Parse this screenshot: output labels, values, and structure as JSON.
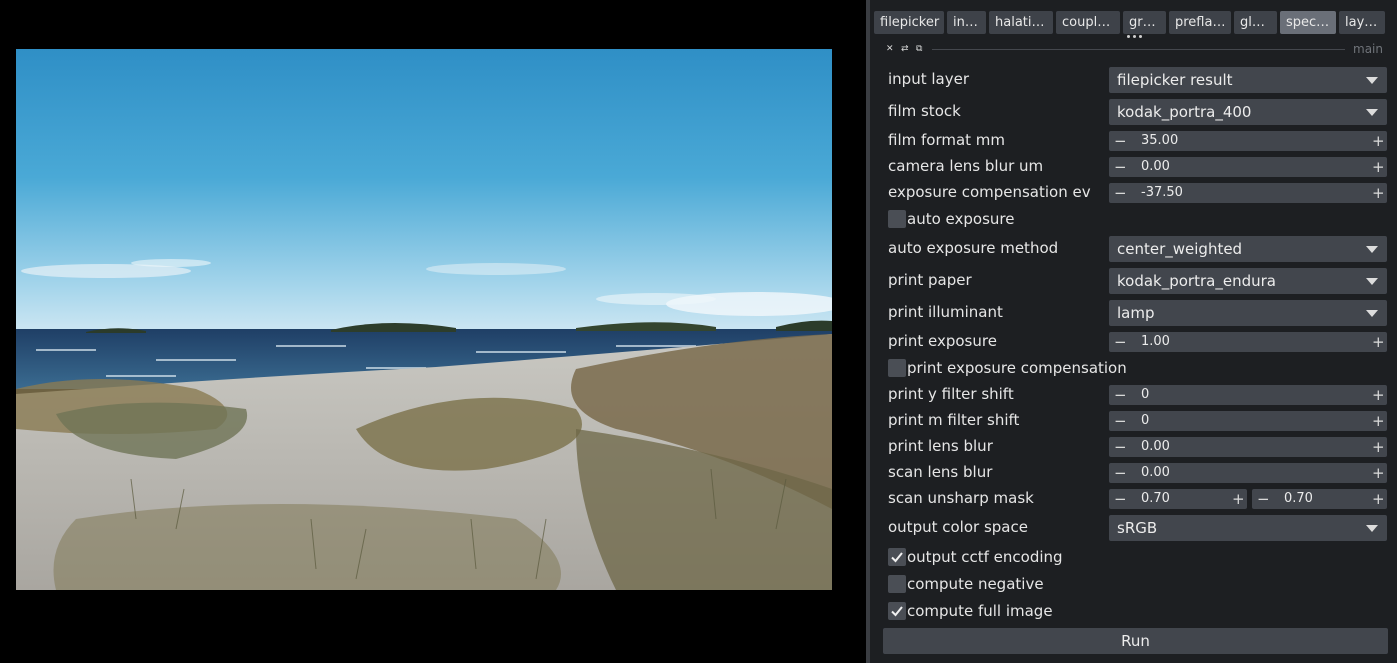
{
  "tabs": [
    {
      "label": "filepicker",
      "width": 70,
      "active": false
    },
    {
      "label": "in…",
      "width": 39,
      "active": false
    },
    {
      "label": "halati…",
      "width": 64,
      "active": false
    },
    {
      "label": "coupl…",
      "width": 64,
      "active": false
    },
    {
      "label": "gr…",
      "width": 43,
      "active": false
    },
    {
      "label": "prefla…",
      "width": 62,
      "active": false
    },
    {
      "label": "gl…",
      "width": 43,
      "active": false
    },
    {
      "label": "spec…",
      "width": 56,
      "active": true
    },
    {
      "label": "lay…",
      "width": 46,
      "active": false
    }
  ],
  "dock": {
    "label": "main"
  },
  "form": {
    "input_layer": {
      "label": "input layer",
      "value": "filepicker result"
    },
    "film_stock": {
      "label": "film stock",
      "value": "kodak_portra_400"
    },
    "film_format_mm": {
      "label": "film format mm",
      "value": "35.00"
    },
    "camera_lens_blur_um": {
      "label": "camera lens blur um",
      "value": "0.00"
    },
    "exposure_compensation_ev": {
      "label": "exposure compensation ev",
      "value": "-37.50"
    },
    "auto_exposure": {
      "label": "auto exposure",
      "checked": false
    },
    "auto_exposure_method": {
      "label": "auto exposure method",
      "value": "center_weighted"
    },
    "print_paper": {
      "label": "print paper",
      "value": "kodak_portra_endura"
    },
    "print_illuminant": {
      "label": "print illuminant",
      "value": "lamp"
    },
    "print_exposure": {
      "label": "print exposure",
      "value": "1.00"
    },
    "print_exposure_compensation": {
      "label": "print exposure compensation",
      "checked": false
    },
    "print_y_filter_shift": {
      "label": "print y filter shift",
      "value": "0"
    },
    "print_m_filter_shift": {
      "label": "print m filter shift",
      "value": "0"
    },
    "print_lens_blur": {
      "label": "print lens blur",
      "value": "0.00"
    },
    "scan_lens_blur": {
      "label": "scan lens blur",
      "value": "0.00"
    },
    "scan_unsharp_mask": {
      "label": "scan unsharp mask",
      "value1": "0.70",
      "value2": "0.70"
    },
    "output_color_space": {
      "label": "output color space",
      "value": "sRGB"
    },
    "output_cctf_encoding": {
      "label": "output cctf encoding",
      "checked": true
    },
    "compute_negative": {
      "label": "compute negative",
      "checked": false
    },
    "compute_full_image": {
      "label": "compute full image",
      "checked": true
    }
  },
  "run_button": {
    "label": "Run"
  },
  "icons": {
    "close": "close-icon",
    "pin": "pin-icon",
    "float": "float-icon",
    "dropdown": "chevron-down-icon",
    "check": "checkmark-icon"
  },
  "colors": {
    "panel_bg": "#1d1f22",
    "widget_bg": "#42464d",
    "tab_active": "#6a6f78"
  }
}
